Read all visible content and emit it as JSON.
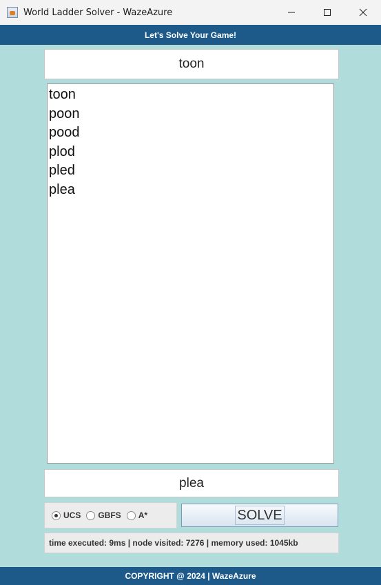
{
  "window": {
    "title": "World Ladder Solver - WazeAzure",
    "icon": "java-app-icon",
    "controls": [
      "minimize-icon",
      "maximize-icon",
      "close-icon"
    ]
  },
  "header": {
    "text": "Let's Solve Your Game!"
  },
  "start_word": {
    "value": "toon"
  },
  "results": {
    "lines": [
      "toon",
      "poon",
      "pood",
      "plod",
      "pled",
      "plea"
    ]
  },
  "end_word": {
    "value": "plea"
  },
  "algorithms": {
    "options": [
      {
        "label": "UCS",
        "checked": true
      },
      {
        "label": "GBFS",
        "checked": false
      },
      {
        "label": "A*",
        "checked": false
      }
    ]
  },
  "solve_button": {
    "label": "SOLVE"
  },
  "stats": {
    "text": "time executed: 9ms |  node visited: 7276 |  memory used: 1045kb"
  },
  "footer": {
    "text": "COPYRIGHT @ 2024 | WazeAzure"
  },
  "colors": {
    "background": "#b0dcdc",
    "band": "#1d5a8a"
  }
}
